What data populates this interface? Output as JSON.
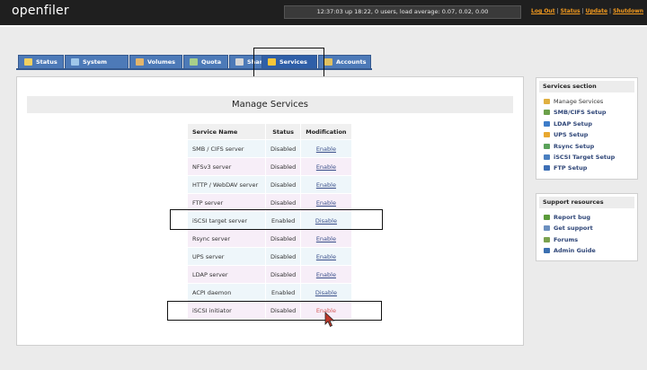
{
  "header": {
    "logo": "openfiler",
    "uptime": "12:37:03 up 18:22, 0 users, load average: 0.07, 0.02, 0.00",
    "links": [
      "Log Out",
      "Status",
      "Update",
      "Shutdown"
    ]
  },
  "tabs": [
    {
      "label": "Status",
      "icon": "status-icon"
    },
    {
      "label": "System",
      "icon": "system-icon"
    },
    {
      "label": "Volumes",
      "icon": "volumes-icon"
    },
    {
      "label": "Quota",
      "icon": "quota-icon"
    },
    {
      "label": "Shares",
      "icon": "shares-icon"
    },
    {
      "label": "Services",
      "icon": "lightning-icon",
      "active": true
    },
    {
      "label": "Accounts",
      "icon": "accounts-icon"
    }
  ],
  "main": {
    "title": "Manage Services",
    "columns": [
      "Service Name",
      "Status",
      "Modification"
    ],
    "rows": [
      {
        "name": "SMB / CIFS server",
        "status": "Disabled",
        "action": "Enable"
      },
      {
        "name": "NFSv3 server",
        "status": "Disabled",
        "action": "Enable"
      },
      {
        "name": "HTTP / WebDAV server",
        "status": "Disabled",
        "action": "Enable"
      },
      {
        "name": "FTP server",
        "status": "Disabled",
        "action": "Enable"
      },
      {
        "name": "iSCSI target server",
        "status": "Enabled",
        "action": "Disable"
      },
      {
        "name": "Rsync server",
        "status": "Disabled",
        "action": "Enable"
      },
      {
        "name": "UPS server",
        "status": "Disabled",
        "action": "Enable"
      },
      {
        "name": "LDAP server",
        "status": "Disabled",
        "action": "Enable"
      },
      {
        "name": "ACPI daemon",
        "status": "Enabled",
        "action": "Disable"
      },
      {
        "name": "iSCSI initiator",
        "status": "Disabled",
        "action": "Enable"
      }
    ]
  },
  "sidebar": {
    "services_title": "Services section",
    "services_items": [
      "Manage Services",
      "SMB/CIFS Setup",
      "LDAP Setup",
      "UPS Setup",
      "Rsync Setup",
      "iSCSI Target Setup",
      "FTP Setup"
    ],
    "support_title": "Support resources",
    "support_items": [
      "Report bug",
      "Get support",
      "Forums",
      "Admin Guide"
    ]
  },
  "colors": {
    "tab": "#4d7ab8",
    "accent_orange": "#f39a1e",
    "link": "#3a4f8a"
  }
}
